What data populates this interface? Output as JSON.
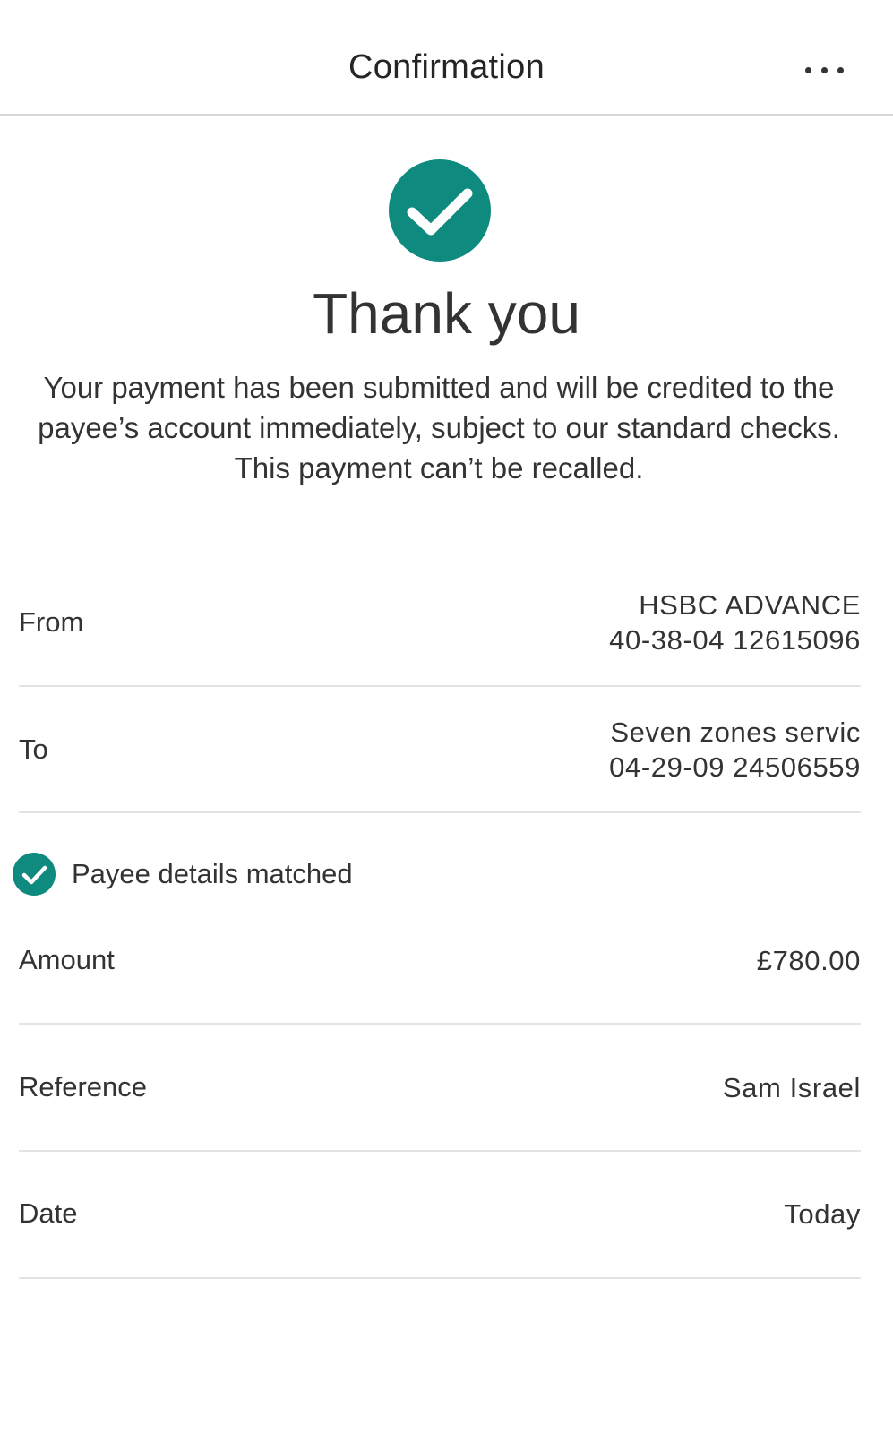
{
  "header": {
    "title": "Confirmation",
    "more_icon": "more-horizontal-icon"
  },
  "colors": {
    "accent": "#0f8a7e",
    "text": "#333333",
    "divider": "#e4e4e4"
  },
  "confirmation": {
    "icon": "check-circle-icon",
    "title": "Thank you",
    "message": "Your payment has been submitted and will be credited to the payee’s account immediately, subject to our standard checks. This payment can’t be recalled."
  },
  "details": {
    "from": {
      "label": "From",
      "account_name": "HSBC ADVANCE",
      "account_number": "40-38-04 12615096"
    },
    "to": {
      "label": "To",
      "payee_name": "Seven zones servic",
      "account_number": "04-29-09 24506559"
    },
    "payee_match": {
      "icon": "check-circle-icon",
      "label": "Payee details matched"
    },
    "amount": {
      "label": "Amount",
      "value": "£780.00"
    },
    "reference": {
      "label": "Reference",
      "value": "Sam Israel"
    },
    "date": {
      "label": "Date",
      "value": "Today"
    }
  }
}
